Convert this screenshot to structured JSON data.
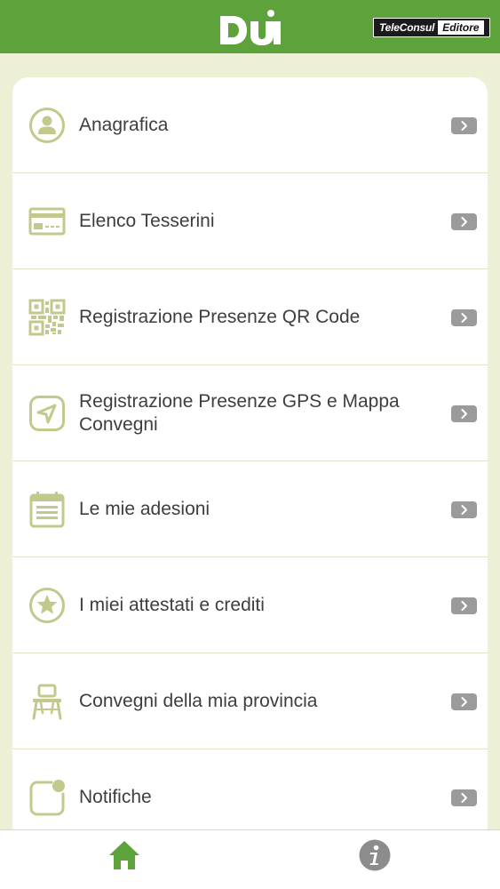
{
  "header": {
    "logo_text": "DU",
    "publisher_name": "TeleConsul",
    "publisher_role": "Editore"
  },
  "menu": {
    "items": [
      {
        "label": "Anagrafica",
        "icon": "user-icon"
      },
      {
        "label": "Elenco Tesserini",
        "icon": "card-icon"
      },
      {
        "label": "Registrazione Presenze QR Code",
        "icon": "qr-code-icon"
      },
      {
        "label": "Registrazione Presenze GPS e Mappa Convegni",
        "icon": "navigation-arrow-icon"
      },
      {
        "label": "Le mie adesioni",
        "icon": "calendar-list-icon"
      },
      {
        "label": "I miei attestati e crediti",
        "icon": "star-badge-icon"
      },
      {
        "label": "Convegni della mia provincia",
        "icon": "chair-icon"
      },
      {
        "label": "Notifiche",
        "icon": "notification-icon"
      }
    ]
  },
  "tabbar": {
    "tabs": [
      {
        "name": "home",
        "icon": "home-icon",
        "active": true
      },
      {
        "name": "info",
        "icon": "info-icon",
        "active": false
      }
    ]
  },
  "colors": {
    "brand_green": "#5ea23b",
    "icon_olive": "#c3c98c",
    "background": "#eef0d6",
    "chevron_gray": "#9b9b9b"
  }
}
